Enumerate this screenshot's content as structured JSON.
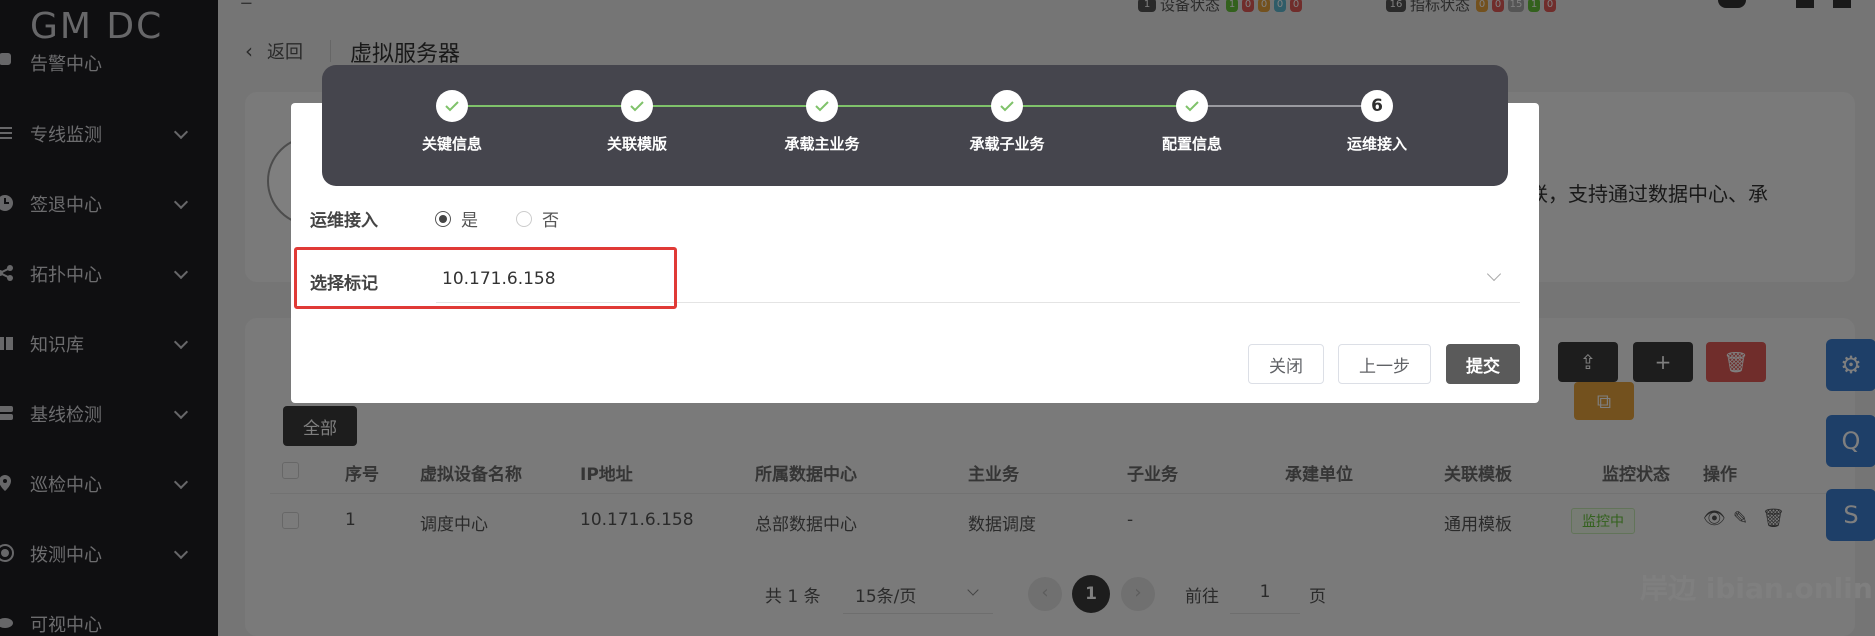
{
  "sidebar": {
    "logo": "GM DC",
    "items": [
      {
        "label": "告警中心",
        "icon": "bell-icon"
      },
      {
        "label": "专线监测",
        "icon": "line-monitor-icon"
      },
      {
        "label": "签退中心",
        "icon": "clock-icon"
      },
      {
        "label": "拓扑中心",
        "icon": "topology-icon"
      },
      {
        "label": "知识库",
        "icon": "book-icon"
      },
      {
        "label": "基线检测",
        "icon": "server-icon"
      },
      {
        "label": "巡检中心",
        "icon": "location-icon"
      },
      {
        "label": "拨测中心",
        "icon": "signal-icon"
      },
      {
        "label": "可视中心",
        "icon": "eye-icon"
      }
    ]
  },
  "topbar": {
    "device_status_label": "设备状态",
    "device_count": "1",
    "device_badges": [
      "1",
      "0",
      "0",
      "0",
      "0"
    ],
    "indicator_status_label": "指标状态",
    "indicator_count": "16",
    "indicator_badges": [
      "0",
      "0",
      "15",
      "1",
      "0"
    ]
  },
  "header": {
    "back_label": "返回",
    "page_title": "虚拟服务器"
  },
  "intro": {
    "text": "联，支持通过数据中心、承"
  },
  "toolbar": {
    "filter_all": "全部",
    "upload_icon": "upload-icon",
    "add_icon": "plus-icon",
    "delete_icon": "trash-icon",
    "copy_icon": "copy-icon"
  },
  "table": {
    "columns": [
      "序号",
      "虚拟设备名称",
      "IP地址",
      "所属数据中心",
      "主业务",
      "子业务",
      "承建单位",
      "关联模板",
      "监控状态",
      "操作"
    ],
    "rows": [
      {
        "index": "1",
        "name": "调度中心",
        "ip": "10.171.6.158",
        "datacenter": "总部数据中心",
        "main_business": "数据调度",
        "sub_business": "-",
        "builder": "",
        "template": "通用模板",
        "status": "监控中"
      }
    ]
  },
  "pagination": {
    "total": "共 1 条",
    "page_size": "15条/页",
    "current_page": "1",
    "goto_label": "前往",
    "goto_value": "1",
    "page_suffix": "页"
  },
  "side_buttons": [
    "Q",
    "S"
  ],
  "colors": {
    "sidebar_bg": "#1f1f23",
    "primary_dark": "#45454d",
    "step_done_line": "#7fc26a",
    "side_button": "#3d7fd1",
    "delete": "#e05a56",
    "copy": "#e6a23c",
    "highlight_border": "#e03a36",
    "status_green": "#67c23a"
  },
  "dialog": {
    "steps": [
      {
        "label": "关键信息",
        "state": "done"
      },
      {
        "label": "关联模版",
        "state": "done"
      },
      {
        "label": "承载主业务",
        "state": "done"
      },
      {
        "label": "承载子业务",
        "state": "done"
      },
      {
        "label": "配置信息",
        "state": "done"
      },
      {
        "label": "运维接入",
        "state": "active",
        "number": "6"
      }
    ],
    "ops_access_label": "运维接入",
    "radio_yes": "是",
    "radio_no": "否",
    "radio_selected": "是",
    "select_mark_label": "选择标记",
    "select_mark_value": "10.171.6.158",
    "buttons": {
      "close": "关闭",
      "prev": "上一步",
      "submit": "提交"
    }
  },
  "watermark": "岸边 ibian.online"
}
